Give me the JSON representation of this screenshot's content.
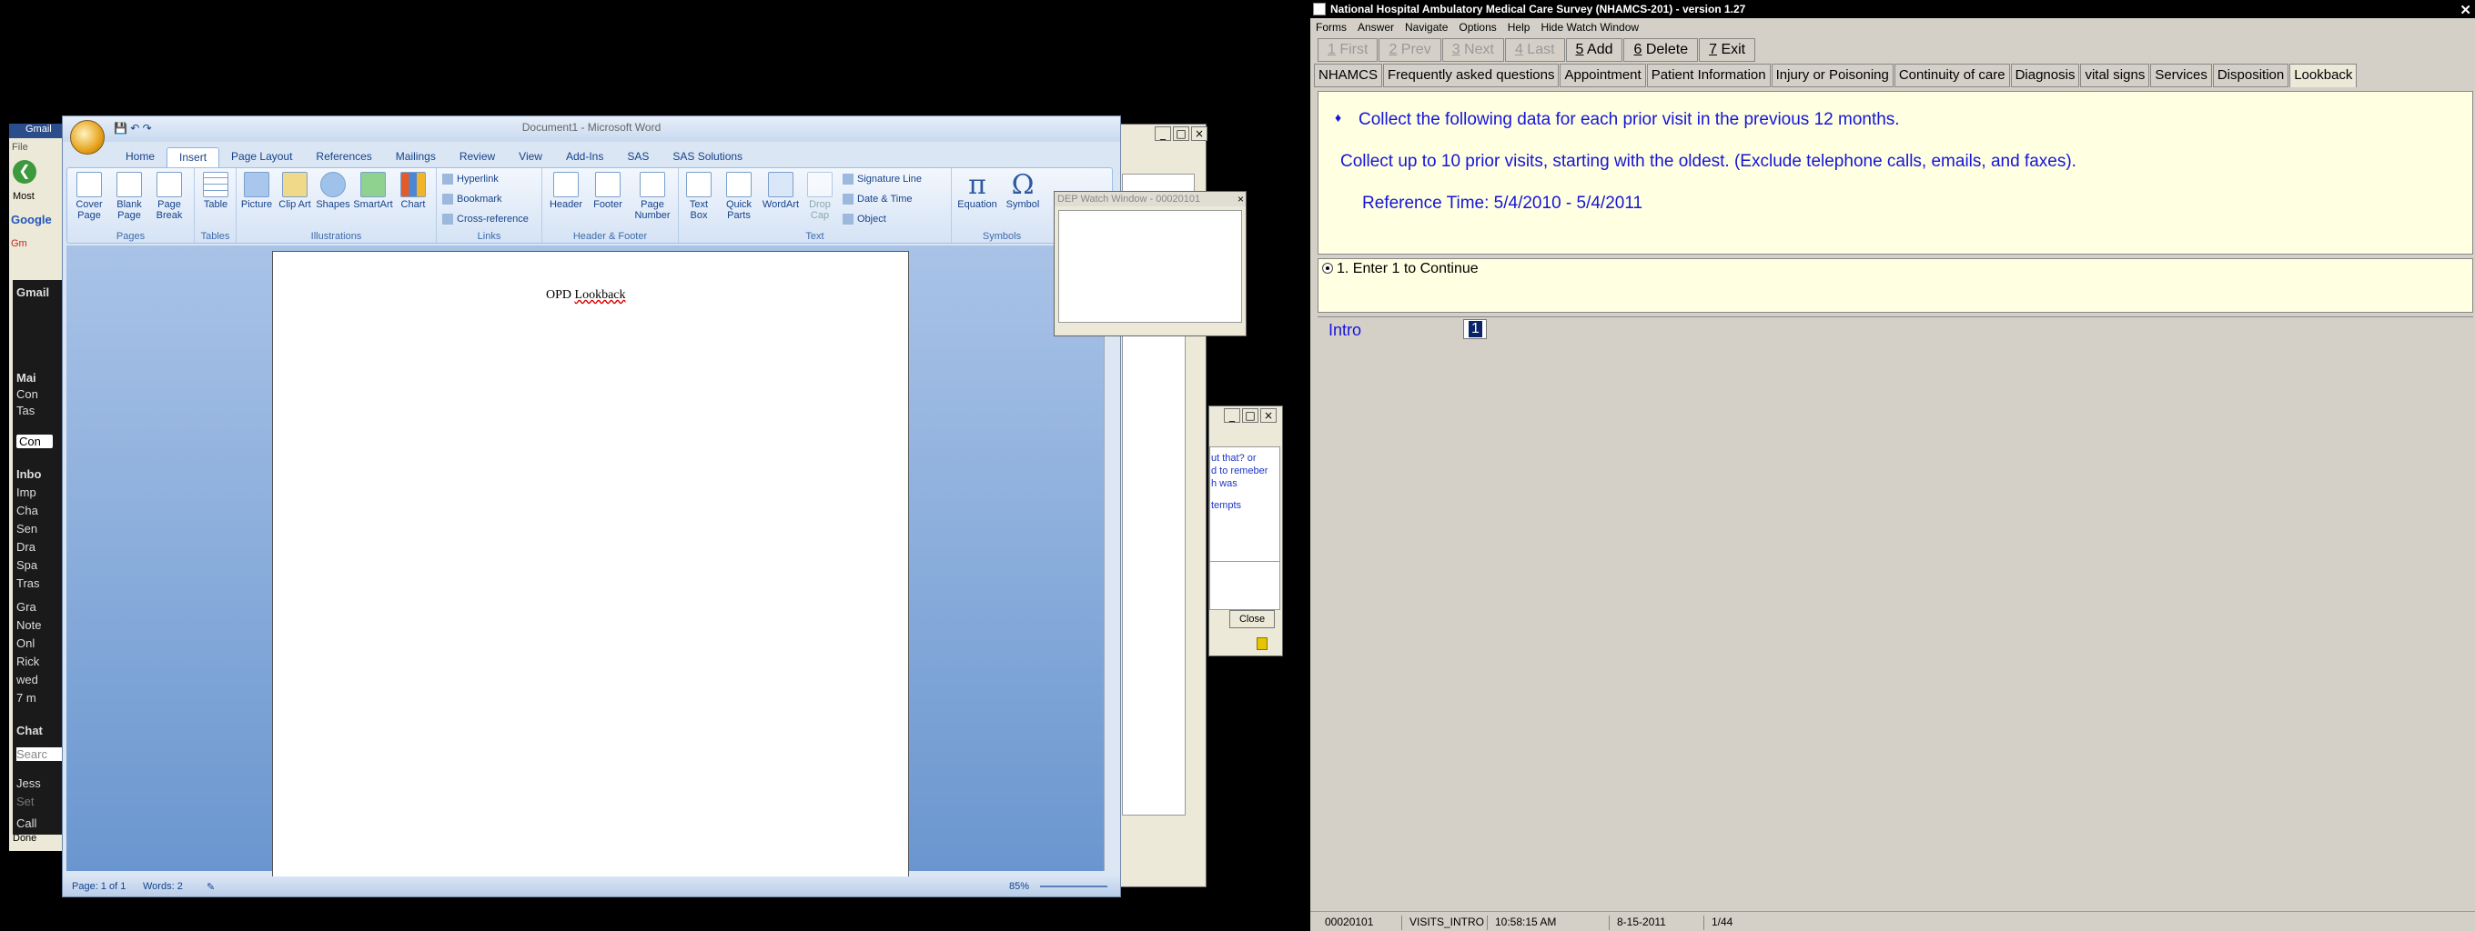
{
  "browser": {
    "title": "Gmail",
    "menu_file": "File",
    "bookmarks": "Most",
    "google": "Google",
    "tab_gm": "Gm",
    "status": "Done",
    "gmail_sidebar": [
      "Gmail",
      "Mai",
      "Con",
      "Tas",
      "Con",
      "Inbo",
      "Imp",
      "Cha",
      "Sen",
      "Dra",
      "Spa",
      "Tras",
      "Gra",
      "Note",
      "Onl",
      "Rick",
      "wed",
      "7 m",
      "Chat",
      "Searc",
      "Jess",
      "Set",
      "Call"
    ]
  },
  "word": {
    "title": "Document1 - Microsoft Word",
    "tabs": [
      "Home",
      "Insert",
      "Page Layout",
      "References",
      "Mailings",
      "Review",
      "View",
      "Add-Ins",
      "SAS",
      "SAS Solutions"
    ],
    "active_tab": "Insert",
    "groups": {
      "pages": {
        "label": "Pages",
        "buttons": [
          "Cover Page",
          "Blank Page",
          "Page Break"
        ]
      },
      "tables": {
        "label": "Tables",
        "buttons": [
          "Table"
        ]
      },
      "illustrations": {
        "label": "Illustrations",
        "buttons": [
          "Picture",
          "Clip Art",
          "Shapes",
          "SmartArt",
          "Chart"
        ]
      },
      "links": {
        "label": "Links",
        "items": [
          "Hyperlink",
          "Bookmark",
          "Cross-reference"
        ]
      },
      "header_footer": {
        "label": "Header & Footer",
        "buttons": [
          "Header",
          "Footer",
          "Page Number"
        ]
      },
      "text": {
        "label": "Text",
        "buttons": [
          "Text Box",
          "Quick Parts",
          "WordArt",
          "Drop Cap"
        ],
        "items": [
          "Signature Line",
          "Date & Time",
          "Object"
        ]
      },
      "symbols": {
        "label": "Symbols",
        "buttons": [
          "Equation",
          "Symbol"
        ]
      }
    },
    "document_text_plain": "OPD ",
    "document_text_underlined": "Lookback",
    "status_page": "Page: 1 of 1",
    "status_words": "Words: 2",
    "zoom": "85%"
  },
  "dep_watch": {
    "title": "DEP Watch Window - 00020101"
  },
  "help_window": {
    "lines": [
      "ut that? or",
      "d to remeber",
      "h was",
      "",
      "tempts"
    ],
    "close_label": "Close"
  },
  "blaise": {
    "title": "National Hospital Ambulatory Medical Care Survey (NHAMCS-201) - version 1.27",
    "menu": [
      "Forms",
      "Answer",
      "Navigate",
      "Options",
      "Help",
      "Hide Watch Window"
    ],
    "toolbar": [
      {
        "key": "1",
        "label": " First",
        "enabled": false
      },
      {
        "key": "2",
        "label": " Prev",
        "enabled": false
      },
      {
        "key": "3",
        "label": " Next",
        "enabled": false
      },
      {
        "key": "4",
        "label": " Last",
        "enabled": false
      },
      {
        "key": "5",
        "label": " Add",
        "enabled": true
      },
      {
        "key": "6",
        "label": " Delete",
        "enabled": true
      },
      {
        "key": "7",
        "label": " Exit",
        "enabled": true
      }
    ],
    "tabs": [
      "NHAMCS",
      "Frequently asked questions",
      "Appointment",
      "Patient Information",
      "Injury or Poisoning",
      "Continuity of care",
      "Diagnosis",
      "vital signs",
      "Services",
      "Disposition",
      "Lookback"
    ],
    "active_tab": "Lookback",
    "question_bullet": "♦",
    "question_line1": "Collect the following data for each prior visit in the previous 12 months.",
    "question_line2": "Collect up to 10 prior visits, starting with the oldest.  (Exclude telephone calls, emails, and faxes).",
    "question_line3": "Reference Time: 5/4/2010 - 5/4/2011",
    "answer_option": "1. Enter 1 to Continue",
    "field_label": "Intro",
    "field_value": "1",
    "status": [
      "00020101",
      "VISITS_INTRO",
      "10:58:15 AM",
      "8-15-2011",
      "1/44"
    ]
  }
}
